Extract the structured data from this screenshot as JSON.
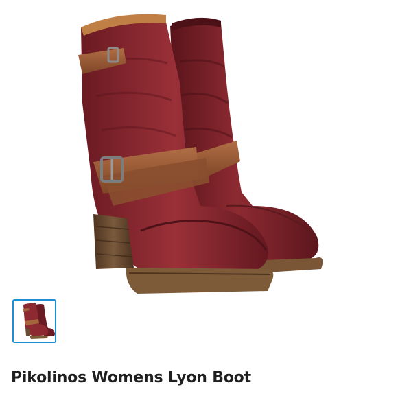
{
  "listing": {
    "title": "Pikolinos Womens Lyon Boot",
    "thumbnails_count": 1,
    "selected_thumbnail": 1
  },
  "colors": {
    "leather": "#7a1f26",
    "strap": "#9a5a38",
    "sole": "#6a4a30",
    "thumb_border": "#1a8fd6",
    "title": "#1f1f1f"
  }
}
